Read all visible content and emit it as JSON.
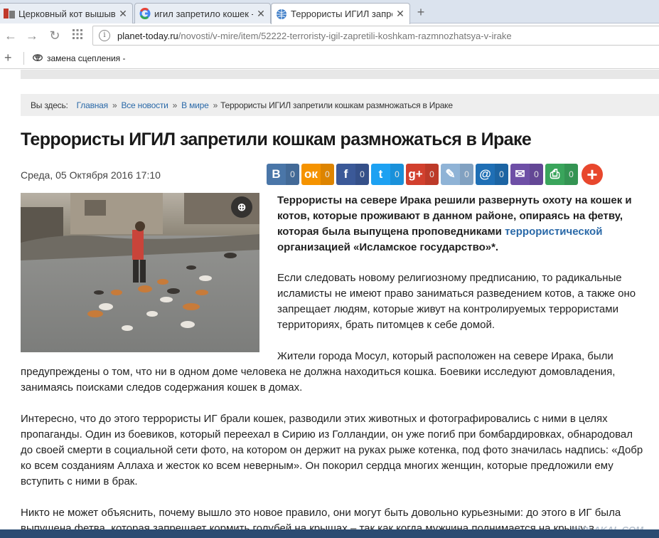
{
  "tabs": [
    {
      "title": "Церковный кот вышывн",
      "favicon": "pikabu-icon",
      "active": false
    },
    {
      "title": "игил запретило кошек - П",
      "favicon": "google-icon",
      "active": false
    },
    {
      "title": "Террористы ИГИЛ запрет",
      "favicon": "globe-icon",
      "active": true
    }
  ],
  "address": {
    "host": "planet-today.ru",
    "path": "/novosti/v-mire/item/52222-terroristy-igil-zapretili-koshkam-razmnozhatsya-v-irake"
  },
  "bookmarks": [
    {
      "label": "замена сцепления -"
    }
  ],
  "breadcrumbs": {
    "label": "Вы здесь:",
    "items": [
      "Главная",
      "Все новости",
      "В мире"
    ],
    "current": "Террористы ИГИЛ запретили кошкам размножаться в Ираке",
    "separator": "»"
  },
  "article": {
    "title": "Террористы ИГИЛ запретили кошкам размножаться в Ираке",
    "date": "Среда, 05 Октября 2016 17:10",
    "lead_before": "Террористы на севере Ирака решили развернуть охоту на кошек и котов, которые проживают в данном районе, опираясь на фетву, которая была выпущена проповедниками ",
    "lead_link": "террористической",
    "lead_after": " организацией «Исламское государство»*.",
    "p1": "Если следовать новому религиозному предписанию, то радикальные исламисты не имеют право заниматься разведением котов, а также оно запрещает людям, которые живут на контролируемых террористами территориях, брать питомцев к себе домой.",
    "p2_first": "Жители города Мосул, который расположен на севере Ирака, были",
    "p2_rest": "предупреждены о том, что ни в одном доме человека не должна находиться кошка. Боевики исследуют домовладения, занимаясь поисками следов содержания кошек в домах.",
    "p3": "Интересно, что до этого террористы ИГ брали кошек, разводили этих животных и фотографировались с ними в целях пропаганды. Один из боевиков, который переехал в Сирию из Голландии, он уже погиб при бомбардировках, обнародовал до своей смерти в социальной сети фото, на котором он держит на руках рыже котенка, под фото значилась надпись: «Добр ко всем созданиям Аллаха и жесток ко всем неверным». Он покорил сердца многих женщин, которые предложили ему вступить с ними в брак.",
    "p4": "Никто не может объяснить, почему вышло это новое правило, они могут быть довольно курьезными: до этого в ИГ была выпущена фетва, которая запрещает кормить голубей на крышах – так как когда мужчина поднимается на крышу в"
  },
  "share_buttons": [
    {
      "glyph": "В",
      "count": "0",
      "color": "#4a76a8",
      "icon": "vk-icon"
    },
    {
      "glyph": "ок",
      "count": "0",
      "color": "#f59300",
      "icon": "odnoklassniki-icon"
    },
    {
      "glyph": "f",
      "count": "0",
      "color": "#3b5998",
      "icon": "facebook-icon"
    },
    {
      "glyph": "t",
      "count": "0",
      "color": "#1da1f2",
      "icon": "twitter-icon"
    },
    {
      "glyph": "g+",
      "count": "0",
      "color": "#d2402e",
      "icon": "google-plus-icon"
    },
    {
      "glyph": "✎",
      "count": "0",
      "color": "#8fb3d6",
      "icon": "livejournal-icon"
    },
    {
      "glyph": "@",
      "count": "0",
      "color": "#1f6fb5",
      "icon": "mailru-icon"
    },
    {
      "glyph": "✉",
      "count": "0",
      "color": "#6e4fa6",
      "icon": "email-icon"
    },
    {
      "glyph": "⎙",
      "count": "0",
      "color": "#3aa55c",
      "icon": "print-icon"
    }
  ],
  "watermark": "YAPLAKAL.COM"
}
